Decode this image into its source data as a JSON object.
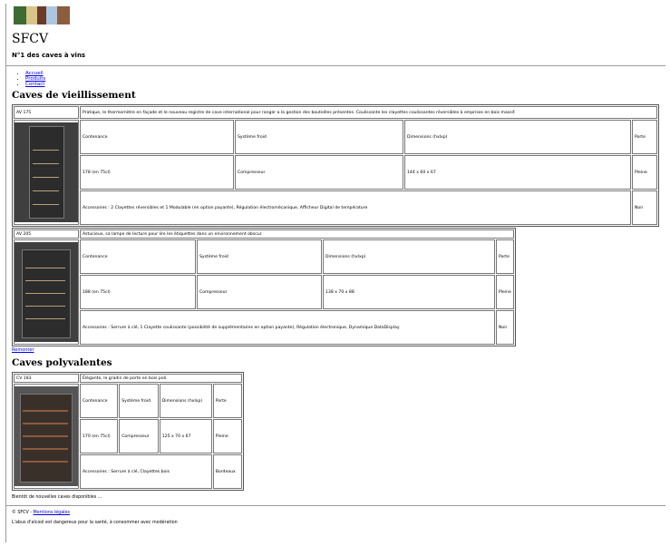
{
  "site": {
    "name": "SFCV",
    "tagline": "N°1 des caves à vins"
  },
  "nav": [
    "Accueil",
    "Produits",
    "Contact"
  ],
  "sections": {
    "vieillissement": {
      "title": "Caves de vieillissement",
      "headers": [
        "Contenance",
        "Système froid",
        "Dimensions (hxlxp)",
        "Porte"
      ],
      "products": [
        {
          "model": "AV 175",
          "description": "Pratique, le thermomètre en façade et le nouveau registre de cave international pour ranger a la gestion des bouteilles présentes. Coulissante les clayettes coulissantes réversibles à emprises en bois massif.",
          "values": [
            "178 (en 75cl)",
            "Compresseur",
            "144 x 60 x 67",
            "Pleine"
          ],
          "accessories": "Accessoires : 2 Clayettes réversibles et 1 Modulable (en option payante), Régulation électromécanique, Afficheur Digital de température",
          "color": "Noir"
        },
        {
          "model": "AV 205",
          "description": "Astucieux, sa lampe de lecture pour lire les étiquettes dans un environnement obscur.",
          "values": [
            "188 (en 75cl)",
            "Compresseur",
            "138 x 70 x 88",
            "Pleine"
          ],
          "accessories": "Accessoires : Serrure à clé, 1 Clayette coulissante (possibilité de supplémentaires en option payante), Régulation électronique, Dynamique DataDisplay",
          "color": "Noir"
        }
      ]
    },
    "polyvalentes": {
      "title": "Caves polyvalentes",
      "headers": [
        "Contenance",
        "Système froid",
        "Dimensions (hxlxp)",
        "Porte"
      ],
      "products": [
        {
          "model": "CV 183",
          "description": "Élégante, le gradin de porte en bois poli.",
          "values": [
            "170 (en 75cl)",
            "Compresseur",
            "125 x 70 x 67",
            "Pleine"
          ],
          "accessories": "Accessoires : Serrure à clé, Clayettes bois",
          "color": "Bordeaux"
        }
      ]
    }
  },
  "links": {
    "back_to_top": "Remonter"
  },
  "footer": {
    "coming_soon": "Bientôt de nouvelles caves disponibles ...",
    "copyright": "© SFCV - ",
    "legal_link": "Mentions légales",
    "warning": "L'abus d'alcool est dangereux pour la santé, à consommer avec modération"
  },
  "colors": {
    "logo": [
      "#3d6b34",
      "#d8c58a",
      "#6c3a2a",
      "#a9c7e1",
      "#8d5d3d"
    ],
    "link": "#0000ee"
  }
}
